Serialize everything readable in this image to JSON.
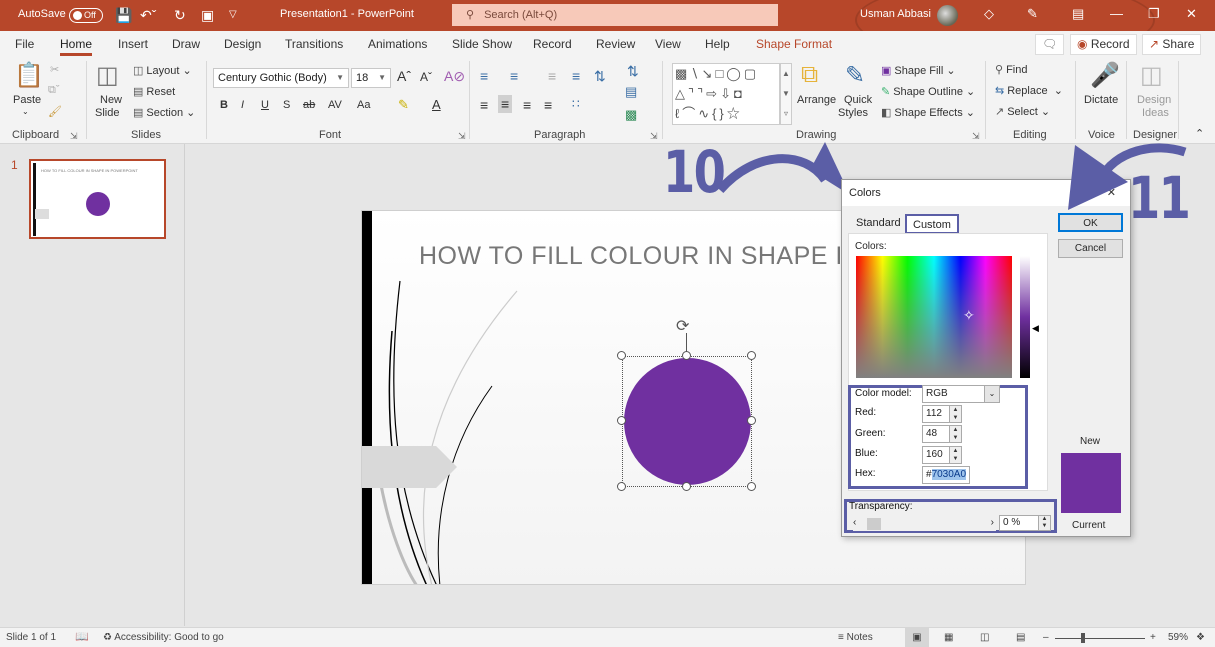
{
  "titlebar": {
    "autosave_label": "AutoSave",
    "autosave_state": "Off",
    "doc_title": "Presentation1 - PowerPoint",
    "search_placeholder": "Search (Alt+Q)",
    "user_name": "Usman Abbasi",
    "brand_color": "#b7472a"
  },
  "menu": {
    "tabs": [
      "File",
      "Home",
      "Insert",
      "Draw",
      "Design",
      "Transitions",
      "Animations",
      "Slide Show",
      "Record",
      "Review",
      "View",
      "Help",
      "Shape Format"
    ],
    "active_tab": "Home",
    "record_button": "Record",
    "share_button": "Share"
  },
  "ribbon": {
    "clipboard": {
      "paste": "Paste",
      "group": "Clipboard"
    },
    "slides": {
      "new_slide_1": "New",
      "new_slide_2": "Slide",
      "layout": "Layout",
      "reset": "Reset",
      "section": "Section",
      "group": "Slides"
    },
    "font": {
      "family": "Century Gothic (Body)",
      "size": "18",
      "group": "Font",
      "bold": "B",
      "italic": "I",
      "underline": "U",
      "shadow": "S",
      "strike": "ab",
      "spacing": "AV",
      "case": "Aa"
    },
    "paragraph": {
      "group": "Paragraph"
    },
    "drawing": {
      "arrange": "Arrange",
      "quick_styles_1": "Quick",
      "quick_styles_2": "Styles",
      "shape_fill": "Shape Fill",
      "shape_outline": "Shape Outline",
      "shape_effects": "Shape Effects",
      "group": "Drawing"
    },
    "editing": {
      "find": "Find",
      "replace": "Replace",
      "select": "Select",
      "group": "Editing"
    },
    "voice": {
      "dictate": "Dictate",
      "group": "Voice"
    },
    "designer": {
      "design_ideas_1": "Design",
      "design_ideas_2": "Ideas",
      "group": "Designer"
    }
  },
  "thumbnails": [
    {
      "number": "1",
      "title": "HOW TO FILL COLOUR IN SHAPE IN POWERPOINT"
    }
  ],
  "slide": {
    "title": "HOW TO FILL COLOUR IN SHAPE IN P",
    "shape_fill_color": "#7030a0"
  },
  "annotations": {
    "step_a": "10",
    "step_b": "11",
    "color": "#5b5ea6"
  },
  "colors_dialog": {
    "title": "Colors",
    "tabs": [
      "Standard",
      "Custom"
    ],
    "active_tab": "Custom",
    "colors_label": "Colors:",
    "color_model_label": "Color model:",
    "color_model_value": "RGB",
    "red_label": "Red:",
    "red_value": "112",
    "green_label": "Green:",
    "green_value": "48",
    "blue_label": "Blue:",
    "blue_value": "160",
    "hex_label": "Hex:",
    "hex_prefix": "#",
    "hex_value": "7030A0",
    "transparency_label": "Transparency:",
    "transparency_value": "0 %",
    "ok": "OK",
    "cancel": "Cancel",
    "new_label": "New",
    "current_label": "Current"
  },
  "statusbar": {
    "slide_info": "Slide 1 of 1",
    "accessibility": "Accessibility: Good to go",
    "notes": "Notes",
    "zoom": "59%"
  }
}
